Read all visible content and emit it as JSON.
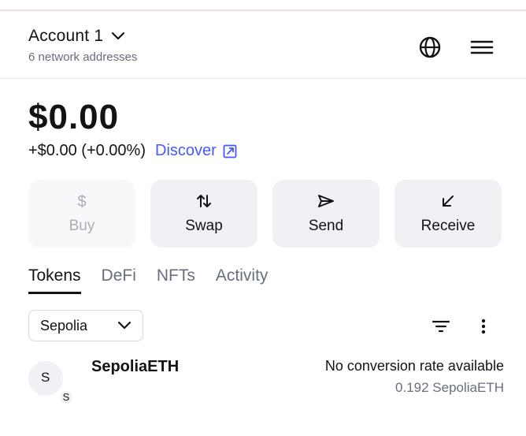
{
  "header": {
    "account_name": "Account 1",
    "subtext": "6 network addresses"
  },
  "balance": {
    "amount": "$0.00",
    "change": "+$0.00 (+0.00%)",
    "discover_label": "Discover"
  },
  "actions": [
    {
      "label": "Buy",
      "icon": "dollar-icon",
      "enabled": false
    },
    {
      "label": "Swap",
      "icon": "swap-icon",
      "enabled": true
    },
    {
      "label": "Send",
      "icon": "send-icon",
      "enabled": true
    },
    {
      "label": "Receive",
      "icon": "receive-icon",
      "enabled": true
    }
  ],
  "tabs": [
    {
      "label": "Tokens",
      "active": true
    },
    {
      "label": "DeFi",
      "active": false
    },
    {
      "label": "NFTs",
      "active": false
    },
    {
      "label": "Activity",
      "active": false
    }
  ],
  "network_filter": {
    "selected": "Sepolia"
  },
  "tokens": [
    {
      "avatar_letter": "S",
      "badge_letter": "S",
      "name": "SepoliaETH",
      "rate_text": "No conversion rate available",
      "amount": "0.192 SepoliaETH"
    }
  ],
  "colors": {
    "accent": "#4459ff",
    "muted": "#686e7d",
    "button_bg": "#f0f1f4",
    "text": "#121314"
  }
}
